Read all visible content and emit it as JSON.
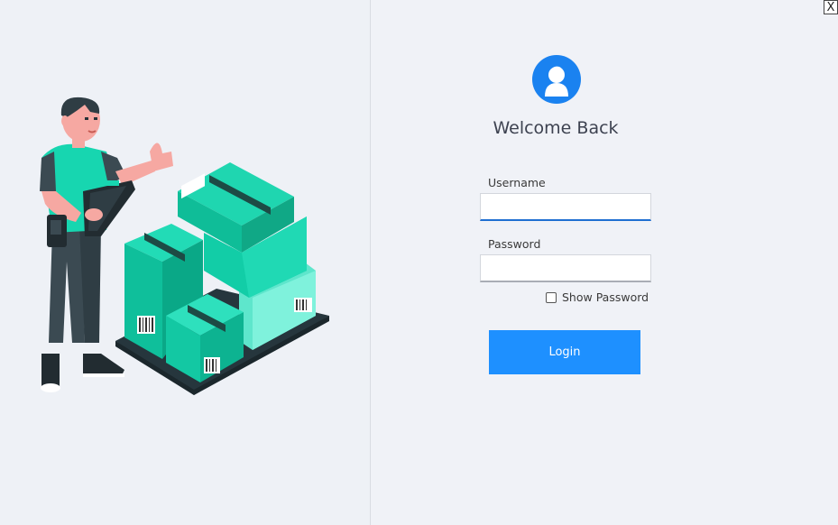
{
  "window": {
    "close_label": "X"
  },
  "login": {
    "title": "Welcome Back",
    "username_label": "Username",
    "username_value": "",
    "password_label": "Password",
    "password_value": "",
    "show_password_label": "Show Password",
    "show_password_checked": false,
    "login_label": "Login"
  },
  "colors": {
    "background": "#eef1f6",
    "accent": "#1e90ff",
    "avatar": "#1a82f0",
    "box_teal": "#14c9a5"
  },
  "icons": {
    "avatar": "user-avatar-icon",
    "illustration": "warehouse-worker-illustration"
  }
}
